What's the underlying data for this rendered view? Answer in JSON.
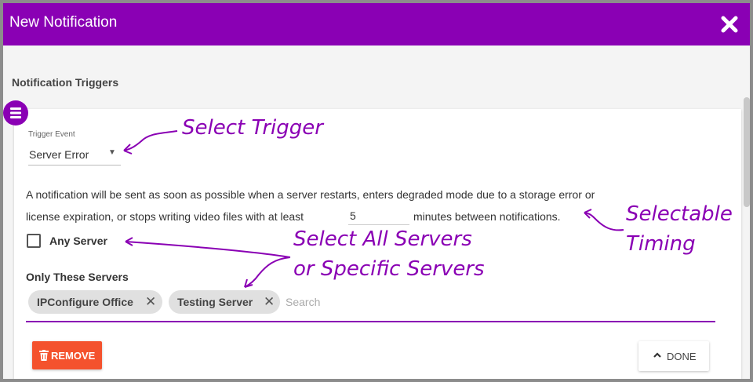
{
  "dialog": {
    "title": "New Notification"
  },
  "section": {
    "title": "Notification Triggers"
  },
  "trigger": {
    "label": "Trigger Event",
    "value": "Server Error"
  },
  "description": {
    "line1": "A notification will be sent as soon as possible when a server restarts, enters degraded mode due to a storage error or",
    "line2_before": "license expiration, or stops writing video files with at least",
    "minutes_value": "5",
    "line2_after": "minutes between notifications."
  },
  "any_server": {
    "label": "Any Server",
    "checked": false
  },
  "servers": {
    "label": "Only These Servers",
    "chips": [
      "IPConfigure Office",
      "Testing Server"
    ],
    "search_placeholder": "Search"
  },
  "actions": {
    "remove_label": "REMOVE",
    "done_label": "DONE"
  },
  "annotations": {
    "select_trigger": "Select Trigger",
    "timing_line1": "Selectable",
    "timing_line2": "Timing",
    "servers_line1": "Select All  Servers",
    "servers_line2": "or Specific Servers"
  },
  "colors": {
    "accent": "#8a00b4",
    "danger": "#f4522d"
  },
  "icons": {
    "close": "close-icon",
    "fab": "list-icon",
    "remove": "trash-icon",
    "done": "chevron-up-icon",
    "chip_remove": "close-icon"
  }
}
